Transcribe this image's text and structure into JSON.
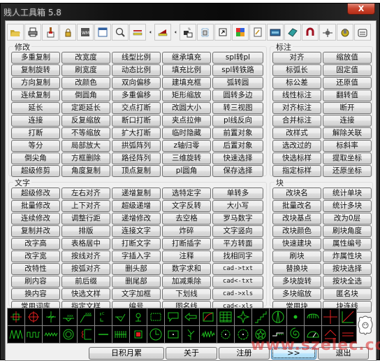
{
  "window": {
    "title": "贱人工具箱 5.8",
    "close_label": "X"
  },
  "toolbar": {
    "icons": [
      {
        "name": "open-folder-icon"
      },
      {
        "name": "print-icon"
      },
      {
        "name": "brush-icon"
      },
      {
        "name": "lock-icon"
      },
      {
        "name": "wmf-icon"
      },
      {
        "name": "window-icon"
      },
      {
        "name": "zoom-search-icon"
      },
      {
        "name": "layer-line-icon"
      },
      {
        "name": "arrow-left-small-icon"
      },
      {
        "name": "layer-fill-icon"
      },
      {
        "name": "arrow-left-small-icon"
      },
      {
        "name": "swap-layers-icon"
      },
      {
        "name": "select-frame-icon"
      },
      {
        "name": "shortcut-icon"
      },
      {
        "name": "color-grid-icon"
      },
      {
        "name": "edit-note-icon"
      },
      {
        "name": "keyboard-screen-icon"
      },
      {
        "name": "eraser-icon"
      },
      {
        "name": "magnet-icon"
      },
      {
        "name": "crosshair-icon"
      },
      {
        "name": "gear-plugin-icon"
      },
      {
        "name": "calculator-icon"
      }
    ]
  },
  "groups": {
    "modify": {
      "label": "修改",
      "buttons": [
        [
          "多重复制",
          "改宽度",
          "线型比例",
          "继承填充",
          "spl转pl"
        ],
        [
          "复制旋转",
          "刷宽度",
          "动态比例",
          "填充比例",
          "spl转铁路"
        ],
        [
          "方向复制",
          "改颜色",
          "双向偏移",
          "建填充框",
          "弧转圆"
        ],
        [
          "连续复制",
          "倒圆角",
          "多重偏移",
          "矩形缩放",
          "圆转多边"
        ],
        [
          "延长",
          "定距延长",
          "交点打断",
          "改圆大小",
          "转三视图"
        ],
        [
          "连接",
          "反复缩放",
          "断口打断",
          "夹点拉伸",
          "pl线反向"
        ],
        [
          "打断",
          "不等缩放",
          "扩大打断",
          "临时隐藏",
          "前置对象"
        ],
        [
          "等分",
          "局部放大",
          "拱弧阵列",
          "z轴归零",
          "后置对象"
        ],
        [
          "倒尖角",
          "方框删除",
          "路径阵列",
          "三维旋转",
          "快速选择"
        ],
        [
          "超级修剪",
          "角度复制",
          "顶点复制",
          "pl圆角",
          "保存选择"
        ]
      ]
    },
    "dimension": {
      "label": "标注",
      "buttons": [
        [
          "对齐",
          "缩放值"
        ],
        [
          "标弧长",
          "固定值"
        ],
        [
          "标公差",
          "还原值"
        ],
        [
          "线性标注",
          "翻转值"
        ],
        [
          "对齐标注",
          "断开"
        ],
        [
          "合并标注",
          "连接"
        ],
        [
          "改样式",
          "解除关联"
        ],
        [
          "选改过的",
          "标斜率"
        ],
        [
          "快选标样",
          "提取坐标"
        ],
        [
          "指定标样",
          "还原坐标"
        ]
      ]
    },
    "text": {
      "label": "文字",
      "buttons": [
        [
          "超级修改",
          "左右对齐",
          "递增复制",
          "选特定字",
          "单转多"
        ],
        [
          "批量修改",
          "上下对齐",
          "超级递增",
          "文字反转",
          "大小写"
        ],
        [
          "连续修改",
          "调整行距",
          "递增修改",
          "去空格",
          "罗马数字"
        ],
        [
          "复制并改",
          "排版",
          "连接文字",
          "炸碎",
          "文字竖向"
        ],
        [
          "改字高",
          "表格居中",
          "打断文字",
          "打断插字",
          "平方转面"
        ],
        [
          "改字宽",
          "按线对齐",
          "字插入字",
          "注释",
          "找相同字"
        ],
        [
          "改特性",
          "按弧对齐",
          "删头部",
          "数字求和",
          "cad->txt"
        ],
        [
          "刷内容",
          "前后缀",
          "删尾部",
          "加减乘除",
          "cad<-txt"
        ],
        [
          "换内容",
          "快选文样",
          "文字加框",
          "下划线",
          "cad->xls"
        ],
        [
          "常用词库",
          "指定文样",
          "编号",
          "图名线",
          "cad<-xls"
        ]
      ]
    },
    "block": {
      "label": "块",
      "buttons": [
        [
          "改块名",
          "统计单块"
        ],
        [
          "批量改名",
          "统计多块"
        ],
        [
          "改块基点",
          "改为0层"
        ],
        [
          "改块颜色",
          "刷块角度"
        ],
        [
          "快速建块",
          "属性编号"
        ],
        [
          "刷块",
          "炸属性块"
        ],
        [
          "替换块",
          "按块选择"
        ],
        [
          "多块旋转",
          "按块全选"
        ],
        [
          "多块缩放",
          "匿名块"
        ],
        [
          "常用块",
          "块连线"
        ]
      ]
    }
  },
  "symbol_palette": {
    "row1": [
      "crosshair-square-symbol",
      "crosshair-circle-symbol",
      "break-line-symbol",
      "weld-symbol",
      "surface-finish-symbol",
      "bracket-symbol",
      "check-weld-symbol",
      "pillar-symbol",
      "cloud-rect-symbol",
      "callout-symbol",
      "arrow-left-symbol",
      "curve-rect-symbol",
      "table-grid-symbol",
      "star-point-symbol",
      "stairs-symbol",
      "north-arrow-symbol",
      "dot-symbol",
      "comb-symbol",
      "cross-lines-symbol",
      "angle-symbol"
    ],
    "row2": [
      "zigzag-wave-symbol",
      "square-wave-symbol",
      "spring-wave-symbol",
      "concentric-circle-symbol",
      "bracket-red-symbol",
      "line-symbol",
      "coil-symbol",
      "hatch-square-symbol",
      "clock-symbol",
      "center-dot-rect-symbol",
      "tree-symbol",
      "noise-wave-symbol",
      "gear-symbol",
      "gear-dot-symbol",
      "star-circle-symbol",
      "stepped-line-symbol",
      "spiral-symbol",
      "protractor-symbol",
      "roof-symbol",
      "double-line-symbol"
    ]
  },
  "bottom_buttons": {
    "accumulate": "日积月累",
    "about": "关于",
    "register": "注册",
    "more": ">>",
    "exit": "退出"
  },
  "watermark": "www.szelec.cc"
}
